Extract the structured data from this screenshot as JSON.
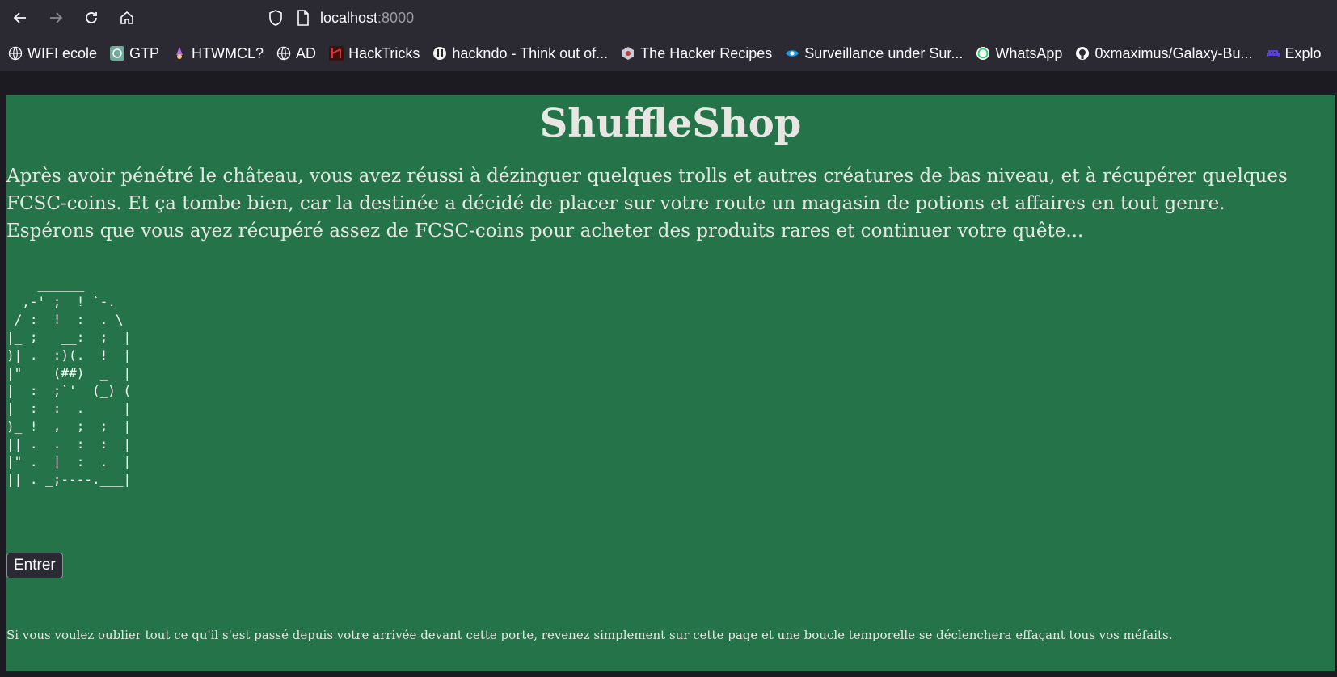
{
  "browser": {
    "url_host": "localhost",
    "url_port": ":8000",
    "bookmarks": [
      {
        "label": "WIFI ecole",
        "icon": "globe-icon"
      },
      {
        "label": "GTP",
        "icon": "openai-icon"
      },
      {
        "label": "HTWMCL?",
        "icon": "wizard-icon"
      },
      {
        "label": "AD",
        "icon": "globe-icon"
      },
      {
        "label": "HackTricks",
        "icon": "hacktricks-icon"
      },
      {
        "label": "hackndo - Think out of...",
        "icon": "hackndo-icon"
      },
      {
        "label": "The Hacker Recipes",
        "icon": "hacker-recipes-icon"
      },
      {
        "label": "Surveillance under Sur...",
        "icon": "eye-icon"
      },
      {
        "label": "WhatsApp",
        "icon": "whatsapp-icon"
      },
      {
        "label": "0xmaximus/Galaxy-Bu...",
        "icon": "github-icon"
      },
      {
        "label": "Explo",
        "icon": "invader-icon"
      }
    ]
  },
  "page": {
    "title": "ShuffleShop",
    "intro": "Après avoir pénétré le château, vous avez réussi à dézinguer quelques trolls et autres créatures de bas niveau, et à récupérer quelques FCSC-coins. Et ça tombe bien, car la destinée a décidé de placer sur votre route un magasin de potions et affaires en tout genre. Espérons que vous ayez récupéré assez de FCSC-coins pour acheter des produits rares et continuer votre quête...",
    "ascii_door": "    ______\n  ,-' ;  ! `-.\n / :  !  :  . \\\n|_ ;   __:  ;  |\n)| .  :)(.  !  |\n|\"    (##)  _  |\n|  :  ;`'  (_) (\n|  :  :  .     |\n)_ !  ,  ;  ;  |\n|| .  .  :  :  |\n|\" .  |  :  .  |\n|| . _;----.___|",
    "enter_label": "Entrer",
    "footer_note": "Si vous voulez oublier tout ce qu'il s'est passé depuis votre arrivée devant cette porte, revenez simplement sur cette page et une boucle temporelle se déclenchera effaçant tous vos méfaits."
  },
  "colors": {
    "page_bg": "#257449",
    "toolbar_bg": "#2b2a33",
    "text": "#e8e6e3"
  }
}
